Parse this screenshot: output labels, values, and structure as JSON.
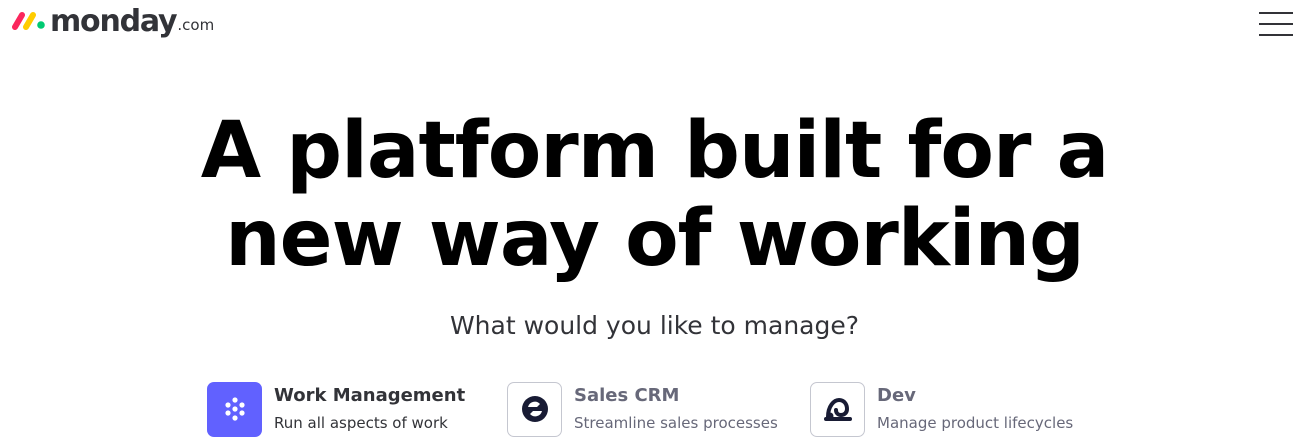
{
  "header": {
    "logo": {
      "brand": "monday",
      "tld": ".com"
    },
    "menu_icon": "hamburger-menu-icon"
  },
  "hero": {
    "title_line1": "A platform built for a",
    "title_line2": "new way of working",
    "subtitle": "What would you like to manage?"
  },
  "products": [
    {
      "title": "Work Management",
      "description": "Run all aspects of work",
      "icon": "work-management-dots-icon",
      "selected": true
    },
    {
      "title": "Sales CRM",
      "description": "Streamline sales processes",
      "icon": "sales-crm-icon",
      "selected": false
    },
    {
      "title": "Dev",
      "description": "Manage product lifecycles",
      "icon": "dev-icon",
      "selected": false
    }
  ],
  "colors": {
    "accent": "#6161ff",
    "logo_red": "#fb275d",
    "logo_yellow": "#ffcc00",
    "logo_green": "#00ca72",
    "text_dark": "#323338",
    "text_muted": "#676879"
  }
}
